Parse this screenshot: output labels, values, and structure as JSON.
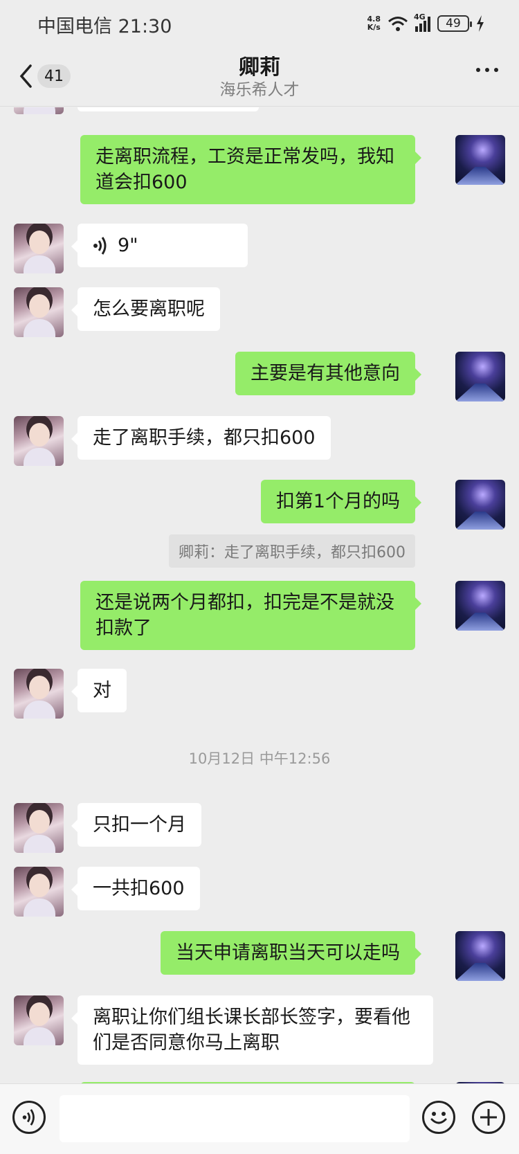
{
  "status_bar": {
    "carrier_time": "中国电信 21:30",
    "net_speed_top": "4.8",
    "net_speed_bottom": "K/s",
    "network": "4G",
    "battery": "49"
  },
  "header": {
    "back_badge": "41",
    "title": "卿莉",
    "subtitle": "海乐希人才"
  },
  "messages": [
    {
      "from": "me",
      "text": "走离职流程，工资是正常发吗，我知道会扣600"
    },
    {
      "from": "them",
      "type": "voice",
      "text": "9\""
    },
    {
      "from": "them",
      "text": "怎么要离职呢"
    },
    {
      "from": "me",
      "text": "主要是有其他意向"
    },
    {
      "from": "them",
      "text": "走了离职手续，都只扣600"
    },
    {
      "from": "me",
      "text": "扣第1个月的吗"
    },
    {
      "from": "quote",
      "text": "卿莉：走了离职手续，都只扣600"
    },
    {
      "from": "me",
      "text": "还是说两个月都扣，扣完是不是就没扣款了"
    },
    {
      "from": "them",
      "text": "对"
    },
    {
      "from": "time",
      "text": "10月12日 中午12:56"
    },
    {
      "from": "them",
      "text": "只扣一个月"
    },
    {
      "from": "them",
      "text": "一共扣600"
    },
    {
      "from": "me",
      "text": "当天申请离职当天可以走吗"
    },
    {
      "from": "them",
      "text": "离职让你们组长课长部长签字，要看他们是否同意你马上离职"
    }
  ],
  "input": {
    "placeholder": ""
  },
  "colors": {
    "my_bubble": "#95ec69",
    "their_bubble": "#ffffff",
    "background": "#ededed"
  },
  "icons": [
    "back-chevron-icon",
    "more-icon",
    "voice-toggle-icon",
    "emoji-icon",
    "plus-icon",
    "voice-wave-icon"
  ]
}
